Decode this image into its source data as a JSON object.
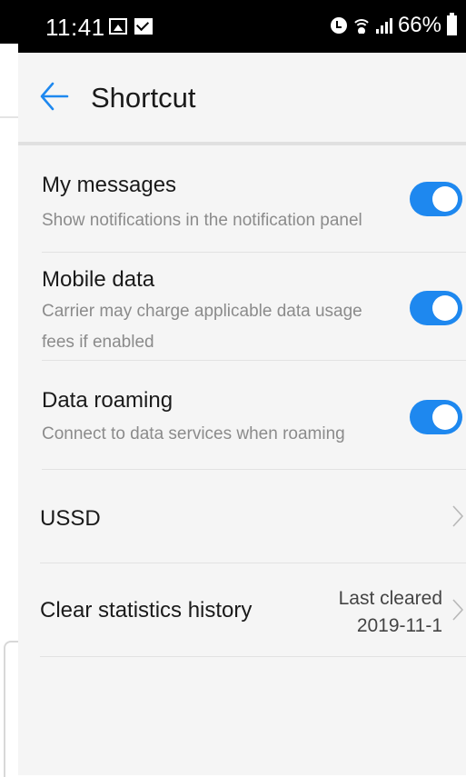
{
  "status_bar": {
    "time": "11:41",
    "battery": "66%",
    "icons_left": [
      "image-icon",
      "mail-icon"
    ],
    "icons_right": [
      "alarm-icon",
      "wifi-icon",
      "signal-icon",
      "battery-icon"
    ]
  },
  "header": {
    "back_icon": "back-arrow-icon",
    "title": "Shortcut"
  },
  "settings": {
    "my_messages": {
      "title": "My messages",
      "subtitle": "Show notifications in the notification panel",
      "enabled": true
    },
    "mobile_data": {
      "title": "Mobile data",
      "subtitle": "Carrier may charge applicable data usage fees if enabled",
      "enabled": true
    },
    "data_roaming": {
      "title": "Data roaming",
      "subtitle": "Connect to data services when roaming",
      "enabled": true
    },
    "ussd": {
      "title": "USSD"
    },
    "clear_statistics": {
      "title": "Clear statistics history",
      "value_label": "Last cleared",
      "value_date": "2019-11-1"
    }
  },
  "colors": {
    "accent": "#1e88ef",
    "background": "#f5f5f5",
    "text_primary": "#1a1a1a",
    "text_secondary": "#8b8b8b"
  }
}
